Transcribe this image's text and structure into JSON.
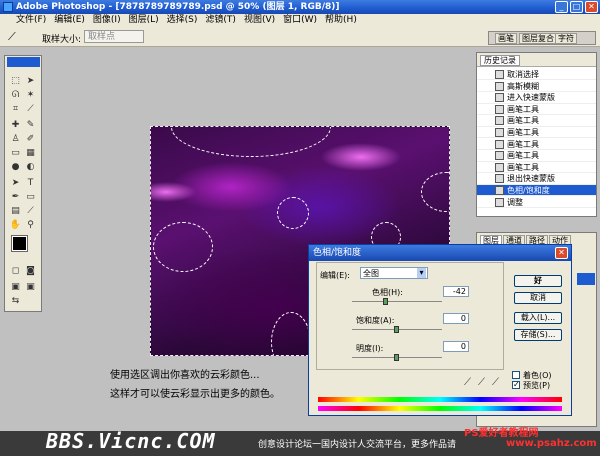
{
  "titlebar": {
    "title": "Adobe Photoshop - [7878789789789.psd @ 50% (图层 1, RGB/8)]"
  },
  "menu": [
    "文件(F)",
    "编辑(E)",
    "图像(I)",
    "图层(L)",
    "选择(S)",
    "滤镜(T)",
    "视图(V)",
    "窗口(W)",
    "帮助(H)"
  ],
  "options": {
    "sample_label": "取样大小:",
    "sample_value": "取样点"
  },
  "palette_well": [
    "画笔",
    "图层复合",
    "字符"
  ],
  "history": {
    "tabs": [
      "历史记录"
    ],
    "items": [
      "取消选择",
      "高斯模糊",
      "进入快速蒙版",
      "画笔工具",
      "画笔工具",
      "画笔工具",
      "画笔工具",
      "画笔工具",
      "画笔工具",
      "退出快速蒙版",
      "色相/饱和度",
      "调整"
    ],
    "active_index": 10
  },
  "layers": {
    "tabs": [
      "图层",
      "通道",
      "路径",
      "动作"
    ]
  },
  "dialog": {
    "title": "色相/饱和度",
    "edit_label": "编辑(E):",
    "edit_value": "全图",
    "hue_label": "色相(H):",
    "hue_value": "-42",
    "hue_level": 0.38,
    "sat_label": "饱和度(A):",
    "sat_value": "0",
    "sat_level": 0.5,
    "light_label": "明度(I):",
    "light_value": "0",
    "light_level": 0.5,
    "buttons": {
      "ok": "好",
      "cancel": "取消",
      "load": "载入(L)...",
      "save": "存储(S)..."
    },
    "colorize": "着色(O)",
    "preview": "预览(P)",
    "preview_checked": true
  },
  "captions": [
    "使用选区调出你喜欢的云彩颜色...",
    "这样才可以使云彩显示出更多的颜色。"
  ],
  "footer": {
    "site": "BBS.Vicnc.COM",
    "text": "创意设计论坛一国内设计人交流平台，更多作品请",
    "brand": "PS爱好者教程网",
    "url": "www.psahz.com"
  }
}
